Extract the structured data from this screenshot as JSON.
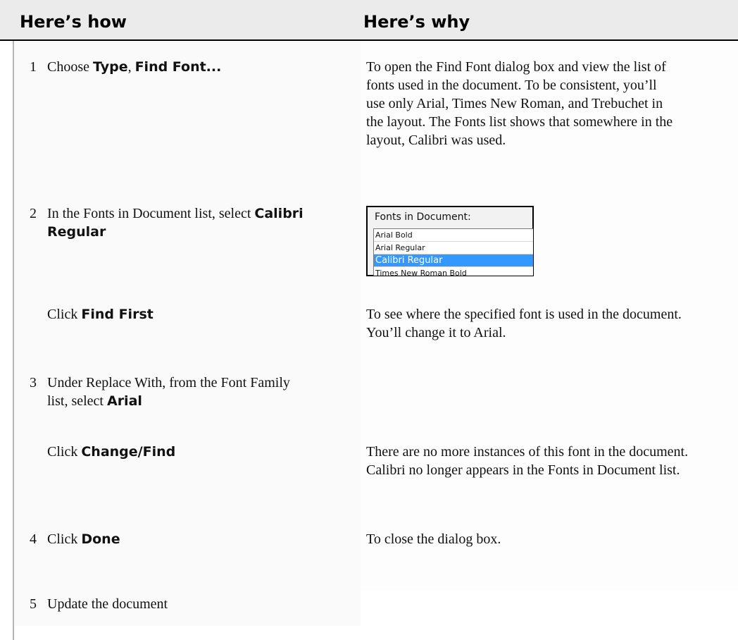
{
  "header": {
    "col_how": "Here’s how",
    "col_why": "Here’s why"
  },
  "steps": [
    {
      "num": "1",
      "how_pre": "Choose ",
      "how_kw1": "Type",
      "how_sep": ", ",
      "how_kw2": "Find Font...",
      "why": "To open the Find Font dialog box and view the list of fonts used in the document. To be consistent, you’ll use only Arial, Times New Roman, and Trebuchet in the layout. The Fonts list shows that somewhere in the layout, Calibri was used."
    },
    {
      "num": "2",
      "how_pre": "In the Fonts in Document list, select ",
      "how_kw": "Calibri Regular"
    },
    {
      "how_pre": "Click ",
      "how_kw": "Find First",
      "why": "To see where the specified font is used in the document. You’ll change it to Arial."
    },
    {
      "num": "3",
      "how_pre": "Under Replace With, from the Font Family list, select ",
      "how_kw": "Arial"
    },
    {
      "how_pre": "Click ",
      "how_kw": "Change/Find",
      "why": "There are no more instances of this font in the document. Calibri no longer appears in the Fonts in Document list."
    },
    {
      "num": "4",
      "how_pre": "Click ",
      "how_kw": "Done",
      "why": "To close the dialog box."
    },
    {
      "num": "5",
      "how_pre": "Update the document"
    }
  ],
  "fonts_panel": {
    "label": "Fonts in Document:",
    "options": [
      "Arial Bold",
      "Arial Regular",
      "Calibri Regular",
      "Times New Roman Bold"
    ],
    "selected": "Calibri Regular",
    "selected_color": "#3399ff"
  }
}
